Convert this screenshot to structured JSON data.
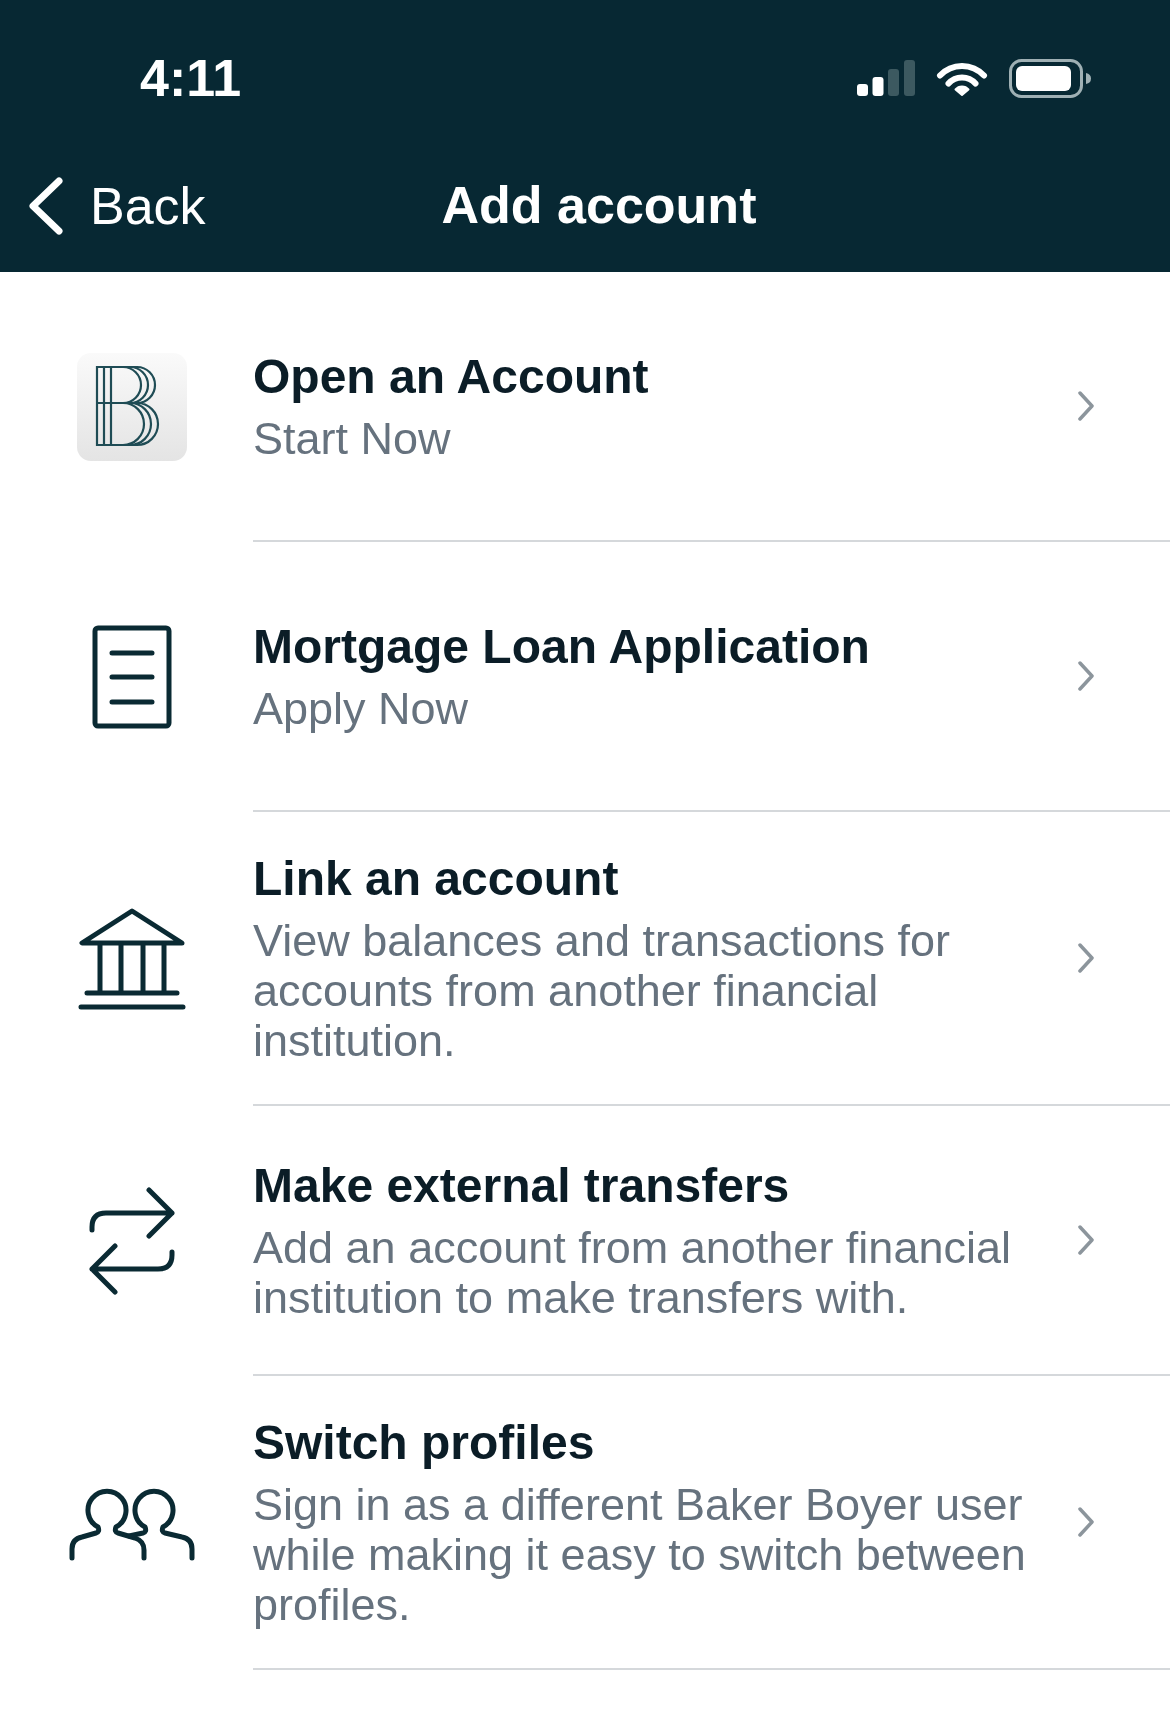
{
  "status_bar": {
    "time": "4:11"
  },
  "nav_bar": {
    "back_label": "Back",
    "title": "Add account"
  },
  "options": [
    {
      "kind": "open",
      "title": "Open an Account",
      "description": "Start Now"
    },
    {
      "kind": "apply",
      "title": "Mortgage Loan Application",
      "description": "Apply Now"
    },
    {
      "kind": "link",
      "title": "Link an account",
      "description": "View balances and transactions for accounts from another financial institution."
    },
    {
      "kind": "transfer",
      "title": "Make external transfers",
      "description": "Add an account from another financial institution to make transfers with."
    },
    {
      "kind": "switch",
      "title": "Switch profiles",
      "description": "Sign in as a different Baker Boyer user while making it easy to switch between profiles."
    }
  ]
}
